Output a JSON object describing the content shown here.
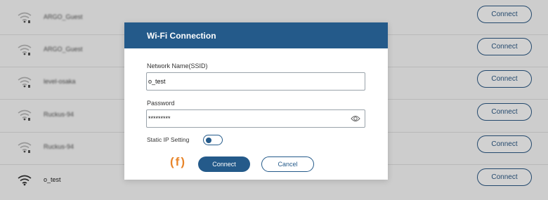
{
  "networks": [
    {
      "ssid": "ARGO_Guest",
      "button": "Connect"
    },
    {
      "ssid": "ARGO_Guest",
      "button": "Connect"
    },
    {
      "ssid": "level-osaka",
      "button": "Connect"
    },
    {
      "ssid": "Ruckus-94",
      "button": "Connect"
    },
    {
      "ssid": "Ruckus-94",
      "button": "Connect"
    },
    {
      "ssid": "o_test",
      "button": "Connect"
    }
  ],
  "dialog": {
    "title": "Wi-Fi Connection",
    "ssid_label": "Network Name(SSID)",
    "ssid_value": "o_test",
    "password_label": "Password",
    "password_value": "*********",
    "static_ip_label": "Static IP Setting",
    "static_ip_enabled": false,
    "marker": "(f)",
    "connect_label": "Connect",
    "cancel_label": "Cancel"
  },
  "colors": {
    "primary": "#245a8a",
    "marker": "#e8852a"
  },
  "icons": {
    "wifi": "wifi-icon",
    "eye": "eye-icon"
  }
}
